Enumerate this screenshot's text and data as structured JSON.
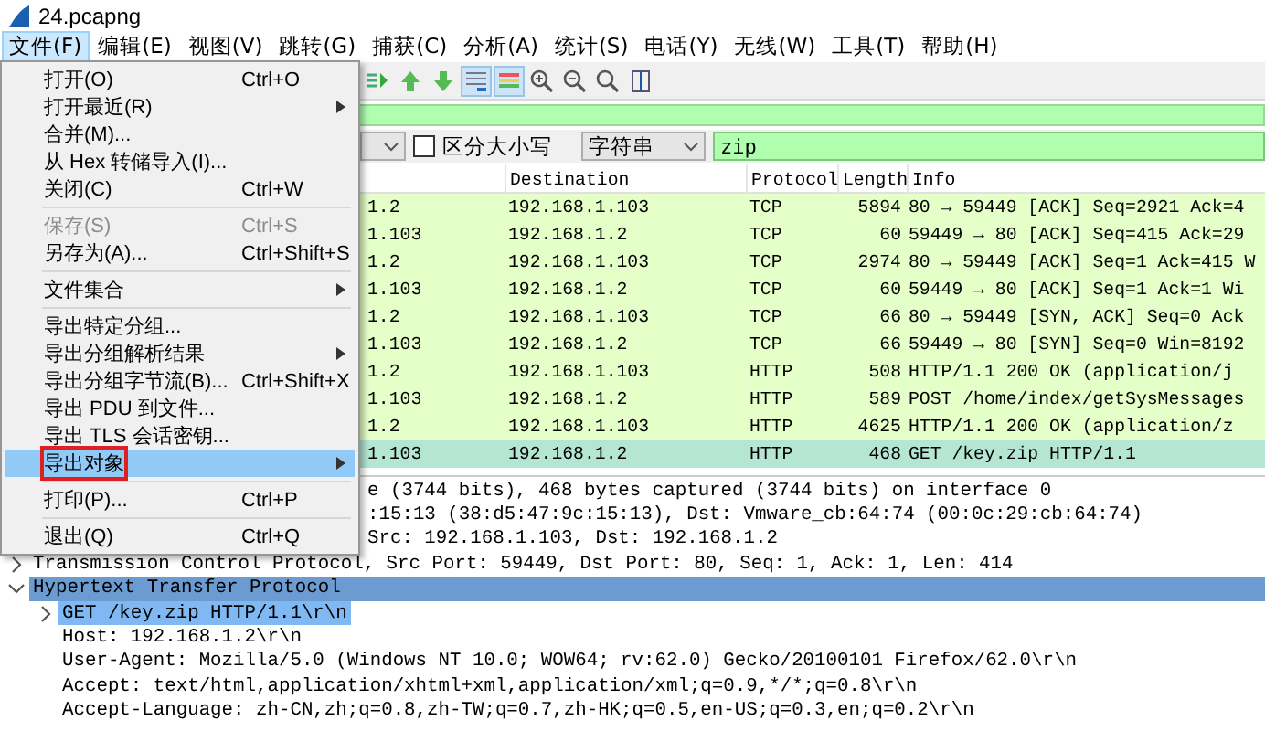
{
  "window": {
    "title": "24.pcapng"
  },
  "menubar": [
    {
      "label": "文件(F)",
      "selected": true
    },
    {
      "label": "编辑(E)",
      "selected": false
    },
    {
      "label": "视图(V)",
      "selected": false
    },
    {
      "label": "跳转(G)",
      "selected": false
    },
    {
      "label": "捕获(C)",
      "selected": false
    },
    {
      "label": "分析(A)",
      "selected": false
    },
    {
      "label": "统计(S)",
      "selected": false
    },
    {
      "label": "电话(Y)",
      "selected": false
    },
    {
      "label": "无线(W)",
      "selected": false
    },
    {
      "label": "工具(T)",
      "selected": false
    },
    {
      "label": "帮助(H)",
      "selected": false
    }
  ],
  "file_menu": [
    {
      "kind": "item",
      "label": "打开(O)",
      "shortcut": "Ctrl+O",
      "disabled": false,
      "selected": false
    },
    {
      "kind": "item",
      "label": "打开最近(R)",
      "submenu": true,
      "disabled": false,
      "selected": false
    },
    {
      "kind": "item",
      "label": "合并(M)...",
      "disabled": false,
      "selected": false
    },
    {
      "kind": "item",
      "label": "从 Hex 转储导入(I)...",
      "disabled": false,
      "selected": false
    },
    {
      "kind": "item",
      "label": "关闭(C)",
      "shortcut": "Ctrl+W",
      "disabled": false,
      "selected": false
    },
    {
      "kind": "separator"
    },
    {
      "kind": "item",
      "label": "保存(S)",
      "shortcut": "Ctrl+S",
      "disabled": true,
      "selected": false
    },
    {
      "kind": "item",
      "label": "另存为(A)...",
      "shortcut": "Ctrl+Shift+S",
      "disabled": false,
      "selected": false
    },
    {
      "kind": "separator"
    },
    {
      "kind": "item",
      "label": "文件集合",
      "submenu": true,
      "disabled": false,
      "selected": false
    },
    {
      "kind": "separator"
    },
    {
      "kind": "item",
      "label": "导出特定分组...",
      "disabled": false,
      "selected": false
    },
    {
      "kind": "item",
      "label": "导出分组解析结果",
      "submenu": true,
      "disabled": false,
      "selected": false
    },
    {
      "kind": "item",
      "label": "导出分组字节流(B)...",
      "shortcut": "Ctrl+Shift+X",
      "disabled": false,
      "selected": false
    },
    {
      "kind": "item",
      "label": "导出 PDU 到文件...",
      "disabled": false,
      "selected": false
    },
    {
      "kind": "item",
      "label": "导出 TLS 会话密钥...",
      "disabled": false,
      "selected": false
    },
    {
      "kind": "item",
      "label": "导出对象",
      "submenu": true,
      "disabled": false,
      "selected": true,
      "outlined": true
    },
    {
      "kind": "separator"
    },
    {
      "kind": "item",
      "label": "打印(P)...",
      "shortcut": "Ctrl+P",
      "disabled": false,
      "selected": false
    },
    {
      "kind": "separator"
    },
    {
      "kind": "item",
      "label": "退出(Q)",
      "shortcut": "Ctrl+Q",
      "disabled": false,
      "selected": false
    }
  ],
  "toolbar": {
    "autoscroll": true,
    "colorize": true
  },
  "search": {
    "case_sensitive_label": "区分大小写",
    "case_sensitive": false,
    "type": "字符串",
    "value": "zip"
  },
  "packet_list": {
    "columns": [
      "Destination",
      "Protocol",
      "Length",
      "Info"
    ],
    "rows": [
      {
        "source": "1.2",
        "destination": "192.168.1.103",
        "protocol": "TCP",
        "length": "5894",
        "info": "80 → 59449 [ACK] Seq=2921 Ack=4",
        "selected": false
      },
      {
        "source": "1.103",
        "destination": "192.168.1.2",
        "protocol": "TCP",
        "length": "60",
        "info": "59449 → 80 [ACK] Seq=415 Ack=29",
        "selected": false
      },
      {
        "source": "1.2",
        "destination": "192.168.1.103",
        "protocol": "TCP",
        "length": "2974",
        "info": "80 → 59449 [ACK] Seq=1 Ack=415 W",
        "selected": false
      },
      {
        "source": "1.103",
        "destination": "192.168.1.2",
        "protocol": "TCP",
        "length": "60",
        "info": "59449 → 80 [ACK] Seq=1 Ack=1 Wi",
        "selected": false
      },
      {
        "source": "1.2",
        "destination": "192.168.1.103",
        "protocol": "TCP",
        "length": "66",
        "info": "80 → 59449 [SYN, ACK] Seq=0 Ack",
        "selected": false
      },
      {
        "source": "1.103",
        "destination": "192.168.1.2",
        "protocol": "TCP",
        "length": "66",
        "info": "59449 → 80 [SYN] Seq=0 Win=8192",
        "selected": false
      },
      {
        "source": "1.2",
        "destination": "192.168.1.103",
        "protocol": "HTTP",
        "length": "508",
        "info": "HTTP/1.1 200 OK  (application/j",
        "selected": false
      },
      {
        "source": "1.103",
        "destination": "192.168.1.2",
        "protocol": "HTTP",
        "length": "589",
        "info": "POST /home/index/getSysMessages",
        "selected": false
      },
      {
        "source": "1.2",
        "destination": "192.168.1.103",
        "protocol": "HTTP",
        "length": "4625",
        "info": "HTTP/1.1 200 OK  (application/z",
        "selected": false
      },
      {
        "source": "1.103",
        "destination": "192.168.1.2",
        "protocol": "HTTP",
        "length": "468",
        "info": "GET /key.zip HTTP/1.1",
        "selected": true
      }
    ]
  },
  "details": [
    {
      "text": "e (3744 bits), 468 bytes captured (3744 bits) on interface 0",
      "covered": true,
      "selected": false,
      "highlighted": false
    },
    {
      "text": ":15:13 (38:d5:47:9c:15:13), Dst: Vmware_cb:64:74 (00:0c:29:cb:64:74)",
      "covered": true,
      "selected": false,
      "highlighted": false
    },
    {
      "text": "Src: 192.168.1.103, Dst: 192.168.1.2",
      "covered": true,
      "selected": false,
      "highlighted": false
    },
    {
      "text": "Transmission Control Protocol, Src Port: 59449, Dst Port: 80, Seq: 1, Ack: 1, Len: 414",
      "expanded": false,
      "selected": false,
      "highlighted": false
    },
    {
      "text": "Hypertext Transfer Protocol",
      "expanded": true,
      "selected": false,
      "highlighted": true,
      "children": [
        {
          "text": "GET /key.zip HTTP/1.1\\r\\n",
          "expanded": false,
          "selected": true,
          "highlighted": false
        },
        {
          "text": "Host: 192.168.1.2\\r\\n",
          "selected": false,
          "highlighted": false
        },
        {
          "text": "User-Agent: Mozilla/5.0 (Windows NT 10.0; WOW64; rv:62.0) Gecko/20100101 Firefox/62.0\\r\\n",
          "selected": false,
          "highlighted": false
        },
        {
          "text": "Accept: text/html,application/xhtml+xml,application/xml;q=0.9,*/*;q=0.8\\r\\n",
          "selected": false,
          "highlighted": false
        },
        {
          "text": "Accept-Language: zh-CN,zh;q=0.8,zh-TW;q=0.7,zh-HK;q=0.5,en-US;q=0.3,en;q=0.2\\r\\n",
          "selected": false,
          "highlighted": false
        }
      ]
    }
  ]
}
